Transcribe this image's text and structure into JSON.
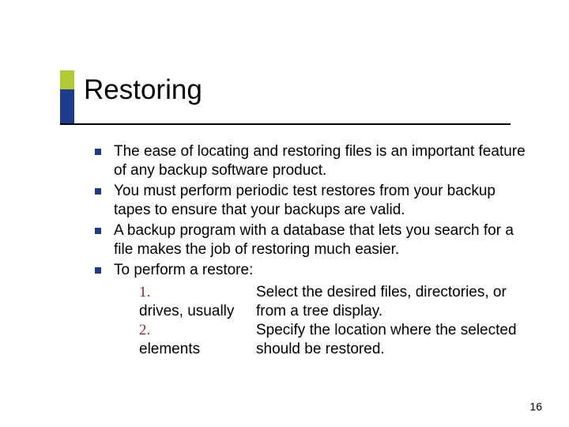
{
  "title": "Restoring",
  "bullets": [
    "The ease of locating and restoring files is an important feature of any backup software product.",
    "You must perform periodic test restores from your backup tapes to ensure that your backups are valid.",
    "A backup program with a database that lets you search for a file makes the job of restoring much easier.",
    "To perform a restore:"
  ],
  "steps": [
    {
      "num": "1.",
      "left_extra": "drives, usually",
      "right_line1": "Select the desired files, directories, or",
      "right_line2": "from a tree display."
    },
    {
      "num": "2.",
      "left_extra": "elements",
      "right_line1": "Specify the location where the selected",
      "right_line2": "should be restored."
    }
  ],
  "page_number": "16"
}
